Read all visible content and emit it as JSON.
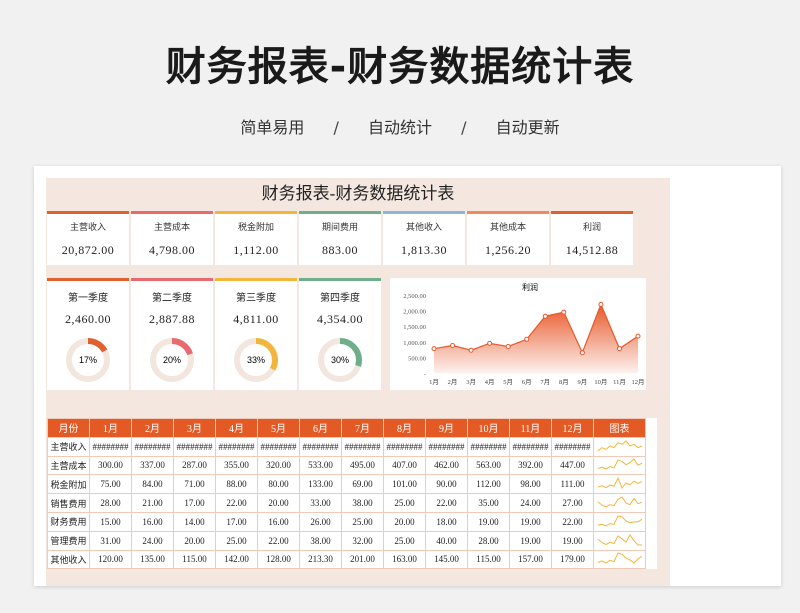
{
  "page": {
    "title": "财务报表-财务数据统计表",
    "subtitle_items": [
      "简单易用",
      "自动统计",
      "自动更新"
    ],
    "separator": "/"
  },
  "sheet": {
    "title": "财务报表-财务数据统计表",
    "kpis": [
      {
        "label": "主营收入",
        "value": "20,872.00",
        "color": "#e0602e"
      },
      {
        "label": "主营成本",
        "value": "4,798.00",
        "color": "#e86a6e"
      },
      {
        "label": "税金附加",
        "value": "1,112.00",
        "color": "#f2b63c"
      },
      {
        "label": "期间费用",
        "value": "883.00",
        "color": "#6fae8a"
      },
      {
        "label": "其他收入",
        "value": "1,813.30",
        "color": "#8fb5d6"
      },
      {
        "label": "其他成本",
        "value": "1,256.20",
        "color": "#f08a5e"
      },
      {
        "label": "利润",
        "value": "14,512.88",
        "color": "#e0602e"
      }
    ],
    "quarters": [
      {
        "label": "第一季度",
        "value": "2,460.00",
        "pct_label": "17%",
        "pct": 0.17,
        "color": "#e0602e"
      },
      {
        "label": "第二季度",
        "value": "2,887.88",
        "pct_label": "20%",
        "pct": 0.2,
        "color": "#e86a6e"
      },
      {
        "label": "第三季度",
        "value": "4,811.00",
        "pct_label": "33%",
        "pct": 0.33,
        "color": "#f2b63c"
      },
      {
        "label": "第四季度",
        "value": "4,354.00",
        "pct_label": "30%",
        "pct": 0.3,
        "color": "#6fae8a"
      }
    ],
    "table": {
      "headers": [
        "月份",
        "1月",
        "2月",
        "3月",
        "4月",
        "5月",
        "6月",
        "7月",
        "8月",
        "9月",
        "10月",
        "11月",
        "12月",
        "图表"
      ],
      "rows": [
        {
          "label": "主营收入",
          "values": [
            "########",
            "########",
            "########",
            "########",
            "########",
            "########",
            "########",
            "########",
            "########",
            "########",
            "########",
            "########"
          ]
        },
        {
          "label": "主营成本",
          "values": [
            "300.00",
            "337.00",
            "287.00",
            "355.00",
            "320.00",
            "533.00",
            "495.00",
            "407.00",
            "462.00",
            "563.00",
            "392.00",
            "447.00"
          ]
        },
        {
          "label": "税金附加",
          "values": [
            "75.00",
            "84.00",
            "71.00",
            "88.00",
            "80.00",
            "133.00",
            "69.00",
            "101.00",
            "90.00",
            "112.00",
            "98.00",
            "111.00"
          ]
        },
        {
          "label": "销售费用",
          "values": [
            "28.00",
            "21.00",
            "17.00",
            "22.00",
            "20.00",
            "33.00",
            "38.00",
            "25.00",
            "22.00",
            "35.00",
            "24.00",
            "27.00"
          ]
        },
        {
          "label": "财务费用",
          "values": [
            "15.00",
            "16.00",
            "14.00",
            "17.00",
            "16.00",
            "26.00",
            "25.00",
            "20.00",
            "18.00",
            "19.00",
            "19.00",
            "22.00"
          ]
        },
        {
          "label": "管理费用",
          "values": [
            "31.00",
            "24.00",
            "20.00",
            "25.00",
            "22.00",
            "38.00",
            "32.00",
            "25.00",
            "40.00",
            "28.00",
            "19.00",
            "19.00"
          ]
        },
        {
          "label": "其他收入",
          "values": [
            "120.00",
            "135.00",
            "115.00",
            "142.00",
            "128.00",
            "213.30",
            "201.00",
            "163.00",
            "145.00",
            "115.00",
            "157.00",
            "179.00"
          ]
        }
      ]
    }
  },
  "chart_data": {
    "type": "area",
    "title": "利润",
    "categories": [
      "1月",
      "2月",
      "3月",
      "4月",
      "5月",
      "6月",
      "7月",
      "8月",
      "9月",
      "10月",
      "11月",
      "12月"
    ],
    "values": [
      780,
      880,
      730,
      950,
      850,
      1080,
      1820,
      1950,
      650,
      2200,
      780,
      1180
    ],
    "yticks": [
      "2,500.00",
      "2,000.00",
      "1,500.00",
      "1,000.00",
      "500.00",
      "-"
    ],
    "ylim": [
      0,
      2500
    ],
    "color": "#e8582a"
  }
}
